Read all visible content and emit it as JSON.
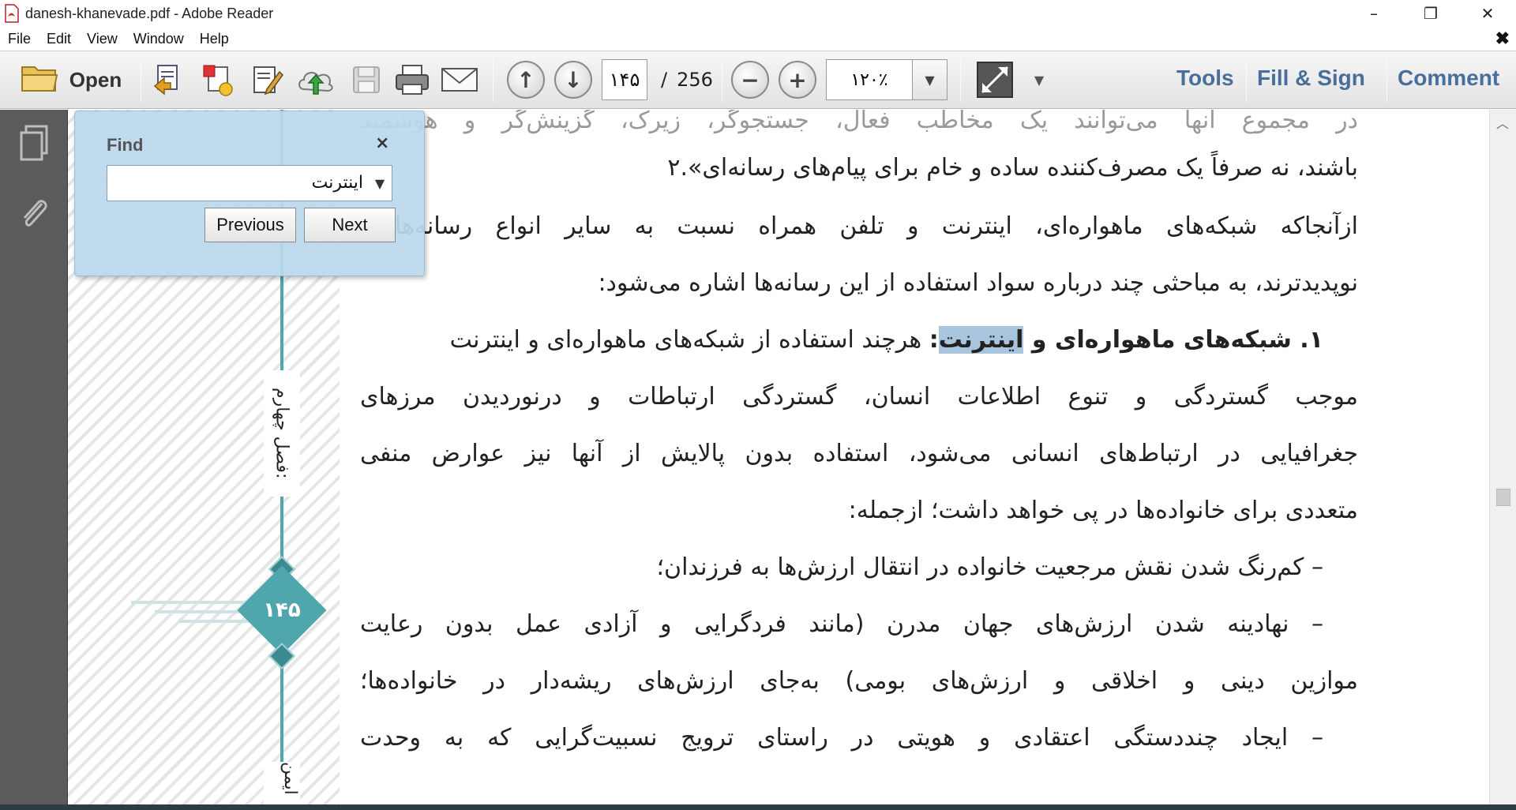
{
  "window": {
    "title": "danesh-khanevade.pdf - Adobe Reader",
    "minimize": "–",
    "restore": "❐",
    "close": "✕"
  },
  "menu": {
    "items": [
      "File",
      "Edit",
      "View",
      "Window",
      "Help"
    ],
    "close_doc": "✖"
  },
  "toolbar": {
    "open_label": "Open",
    "page_current": "۱۴۵",
    "page_separator": "/",
    "page_total": "256",
    "zoom": "۱۲۰٪",
    "tools_label": "Tools",
    "fill_sign_label": "Fill & Sign",
    "comment_label": "Comment"
  },
  "find": {
    "title": "Find",
    "close": "×",
    "query": "اینترنت",
    "previous_label": "Previous",
    "next_label": "Next"
  },
  "page": {
    "chapter_label": "فصل چهارم:",
    "chapter_label_next": "ایمن",
    "page_number": "۱۴۵",
    "lines": [
      "در مجموع آنها می‌توانند یک مخاطب فعال، جستجوگر، زیرک، گزینش‌گر و هوشمند",
      "باشند، نه صرفاً یک مصرف‌کننده ساده و خام برای پیام‌های رسانه‌ای».۲",
      "ازآنجاکه شبکه‌های ماهواره‌ای، اینترنت و تلفن همراه نسبت به سایر انواع رسانه‌ها",
      "نوپدیدترند، به مباحثی چند درباره سواد استفاده از این رسانه‌ها اشاره می‌شود:",
      "موجب گستردگی و تنوع اطلاعات انسان، گستردگی ارتباطات و درنوردیدن مرزهای",
      "جغرافیایی در ارتباط‌های انسانی می‌شود، استفاده بدون پالایش از آنها نیز عوارض منفی",
      "متعددی برای خانواده‌ها در پی خواهد داشت؛ ازجمله:",
      "– کم‌رنگ شدن نقش مرجعیت خانواده در انتقال ارزش‌ها به فرزندان؛",
      "– نهادینه شدن ارزش‌های جهان مدرن (مانند فردگرایی و آزادی عمل بدون رعایت",
      "موازین دینی و اخلاقی و ارزش‌های بومی) به‌جای ارزش‌های ریشه‌دار در خانواده‌ها؛",
      "– ایجاد چنددستگی اعتقادی و هویتی در راستای ترویج نسبیت‌گرایی که به وحدت"
    ],
    "heading_line": {
      "number": "۱. ",
      "bold_prefix": "شبکه‌های ماهواره‌ای و ",
      "highlight": "اینترنت",
      "bold_suffix": ":",
      "rest": " هرچند استفاده از شبکه‌های ماهواره‌ای و اینترنت"
    }
  }
}
